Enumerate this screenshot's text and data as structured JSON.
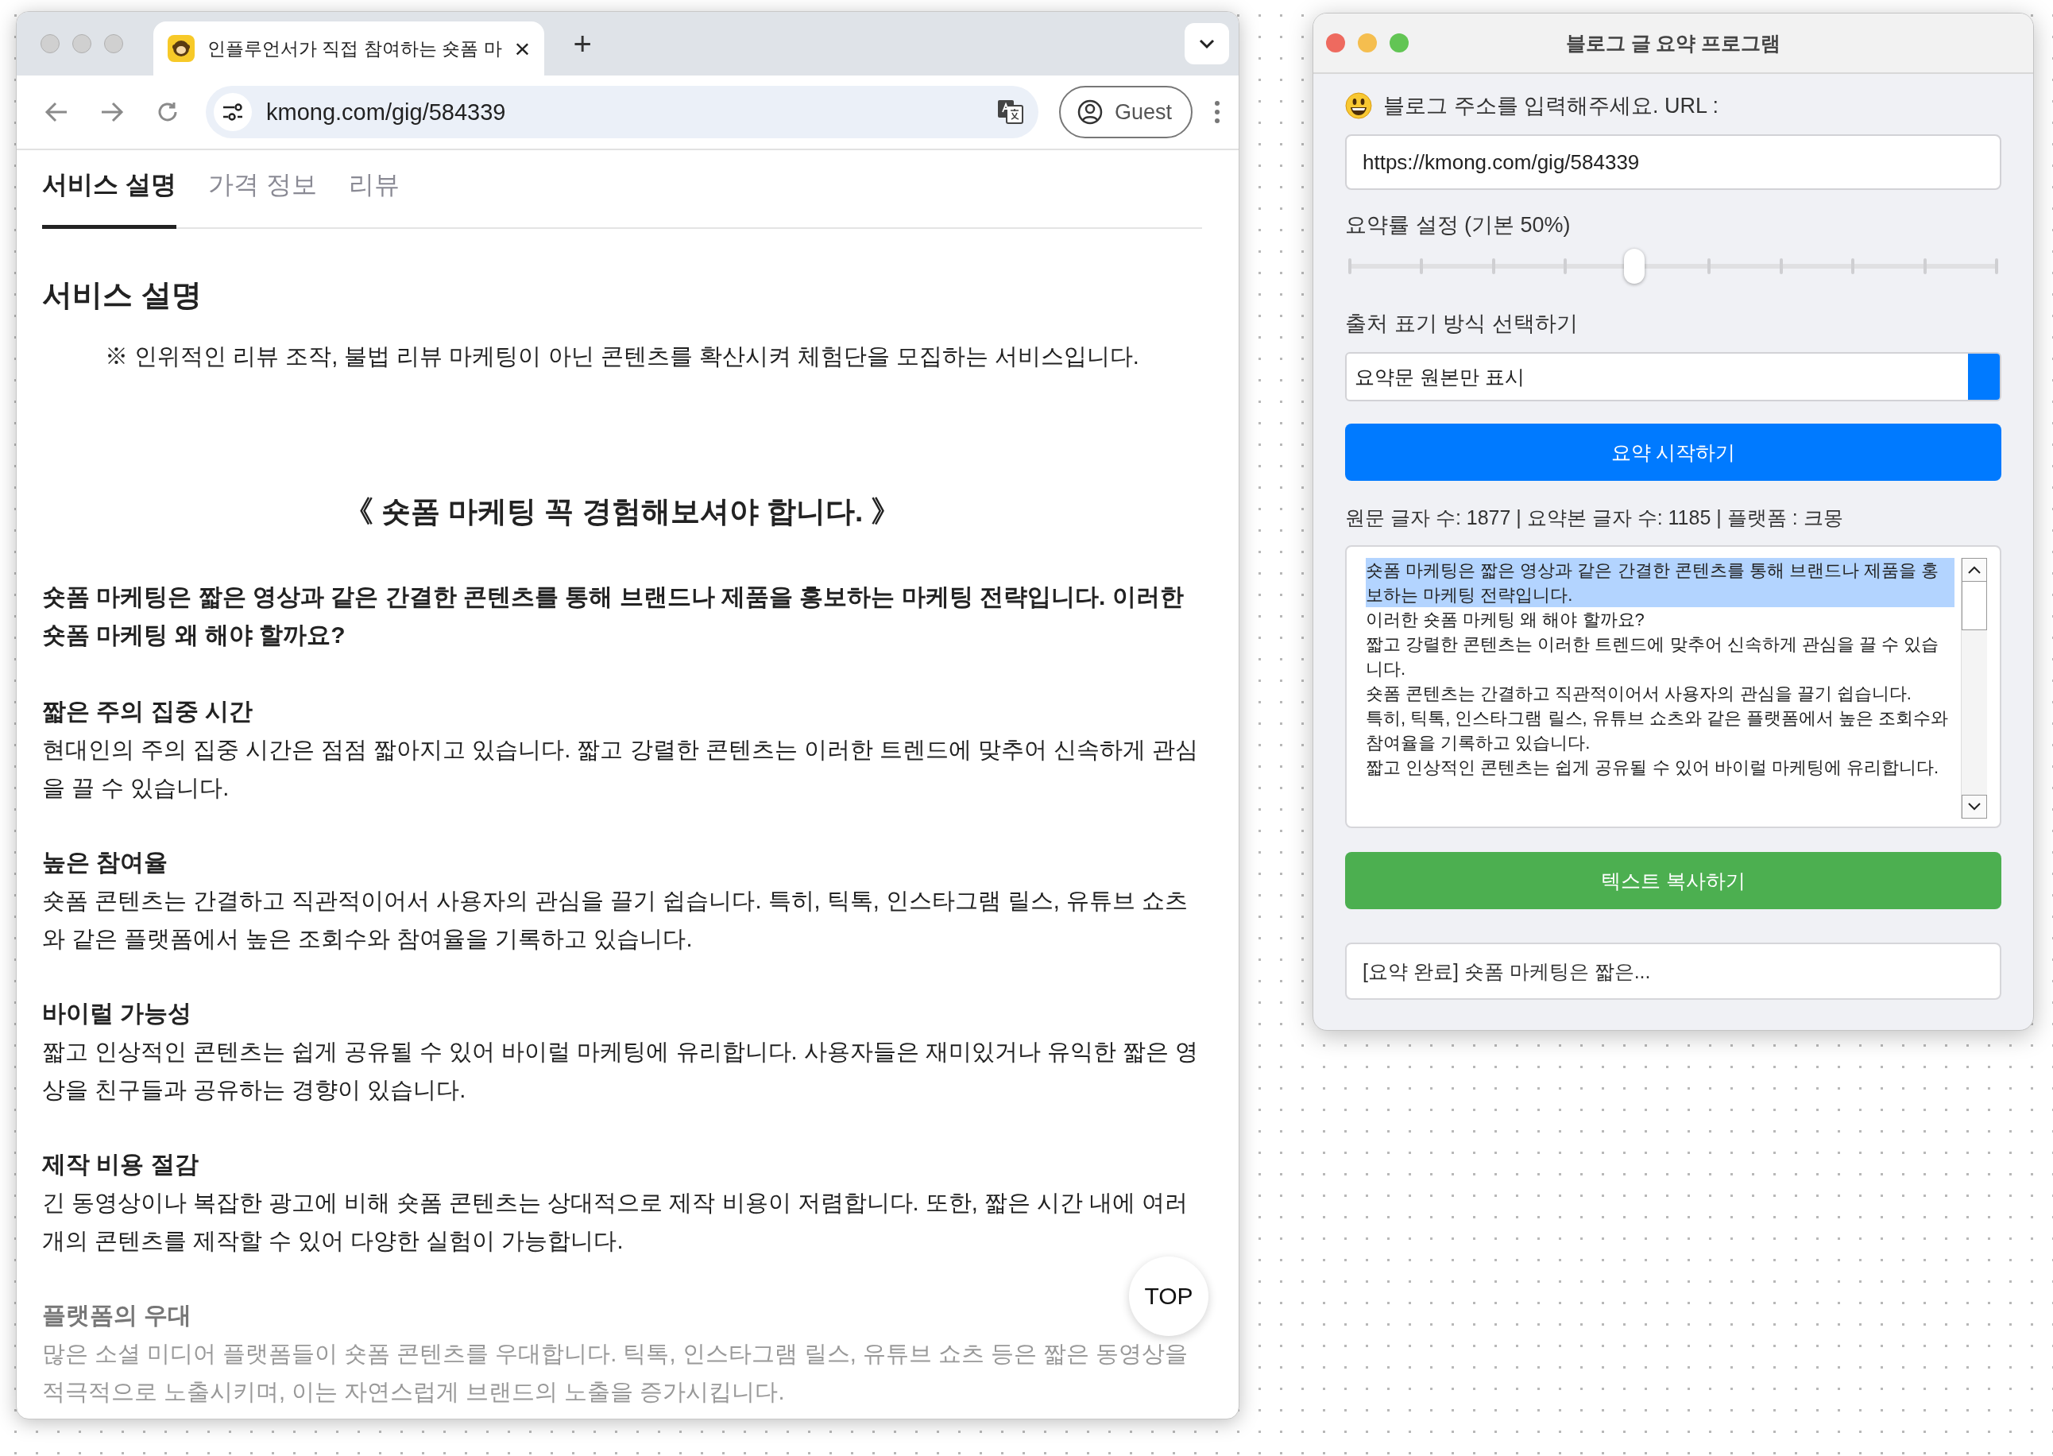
{
  "browser": {
    "tab": {
      "title": "인플루언서가 직접 참여하는 숏폼 마",
      "close": "×"
    },
    "new_tab": "+",
    "address": "kmong.com/gig/584339",
    "profile": "Guest",
    "page_tabs": [
      {
        "label": "서비스 설명",
        "selected": true
      },
      {
        "label": "가격 정보",
        "selected": false
      },
      {
        "label": "리뷰",
        "selected": false
      }
    ],
    "heading": "서비스 설명",
    "notice": "※ 인위적인 리뷰 조작, 불법 리뷰 마케팅이 아닌 콘텐츠를 확산시켜 체험단을 모집하는 서비스입니다.",
    "title": "《 숏폼 마케팅 꼭 경험해보셔야 합니다. 》",
    "intro": "숏폼 마케팅은 짧은 영상과 같은 간결한 콘텐츠를 통해 브랜드나 제품을 홍보하는 마케팅 전략입니다. 이러한 숏폼 마케팅 왜 해야 할까요?",
    "sections": [
      {
        "heading": "짧은 주의 집중 시간",
        "body": "현대인의 주의 집중 시간은 점점 짧아지고 있습니다. 짧고 강렬한 콘텐츠는 이러한 트렌드에 맞추어 신속하게 관심을 끌 수 있습니다.",
        "faded": false
      },
      {
        "heading": "높은 참여율",
        "body": "숏폼 콘텐츠는 간결하고 직관적이어서 사용자의 관심을 끌기 쉽습니다. 특히, 틱톡, 인스타그램 릴스, 유튜브 쇼츠와 같은 플랫폼에서 높은 조회수와 참여율을 기록하고 있습니다.",
        "faded": false
      },
      {
        "heading": "바이럴 가능성",
        "body": "짧고 인상적인 콘텐츠는 쉽게 공유될 수 있어 바이럴 마케팅에 유리합니다. 사용자들은 재미있거나 유익한 짧은 영상을 친구들과 공유하는 경향이 있습니다.",
        "faded": false
      },
      {
        "heading": "제작 비용 절감",
        "body": "긴 동영상이나 복잡한 광고에 비해 숏폼 콘텐츠는 상대적으로 제작 비용이 저렴합니다. 또한, 짧은 시간 내에 여러 개의 콘텐츠를 제작할 수 있어 다양한 실험이 가능합니다.",
        "faded": false
      },
      {
        "heading": "플랫폼의 우대",
        "body": "많은 소셜 미디어 플랫폼들이 숏폼 콘텐츠를 우대합니다. 틱톡, 인스타그램 릴스, 유튜브 쇼츠 등은 짧은 동영상을 적극적으로 노출시키며, 이는 자연스럽게 브랜드의 노출을 증가시킵니다.",
        "faded": true
      }
    ],
    "top_button": "TOP"
  },
  "app": {
    "window": {
      "title": "블로그 글 요약 프로그램"
    },
    "url_label": "블로그 주소를 입력해주세요. URL :",
    "url_value": "https://kmong.com/gig/584339",
    "ratio_label": "요약률 설정 (기본 50%)",
    "ratio": {
      "level": 0.44
    },
    "source_label": "출처 표기 방식 선택하기",
    "source_value": "요약문 원본만 표시",
    "start_button": "요약 시작하기",
    "stats": "원문 글자 수: 1877 | 요약본 글자 수: 1185 | 플랫폼 : 크몽",
    "summary": [
      {
        "text": "숏폼 마케팅은 짧은 영상과 같은 간결한 콘텐츠를 통해 브랜드나 제품을 홍보하는 마케팅 전략입니다.",
        "selected": true
      },
      {
        "text": "이러한 숏폼 마케팅 왜 해야 할까요?",
        "selected": false
      },
      {
        "text": "짧고 강렬한 콘텐츠는 이러한 트렌드에 맞추어 신속하게 관심을 끌 수 있습니다.",
        "selected": false
      },
      {
        "text": "숏폼 콘텐츠는 간결하고 직관적이어서 사용자의 관심을 끌기 쉽습니다.",
        "selected": false
      },
      {
        "text": "특히, 틱톡, 인스타그램 릴스, 유튜브 쇼츠와 같은 플랫폼에서 높은 조회수와 참여율을 기록하고 있습니다.",
        "selected": false
      },
      {
        "text": "짧고 인상적인 콘텐츠는 쉽게 공유될 수 있어 바이럴 마케팅에 유리합니다.",
        "selected": false
      }
    ],
    "copy_button": "텍스트 복사하기",
    "status": "[요약 완료] 숏폼 마케팅은 짧은..."
  }
}
